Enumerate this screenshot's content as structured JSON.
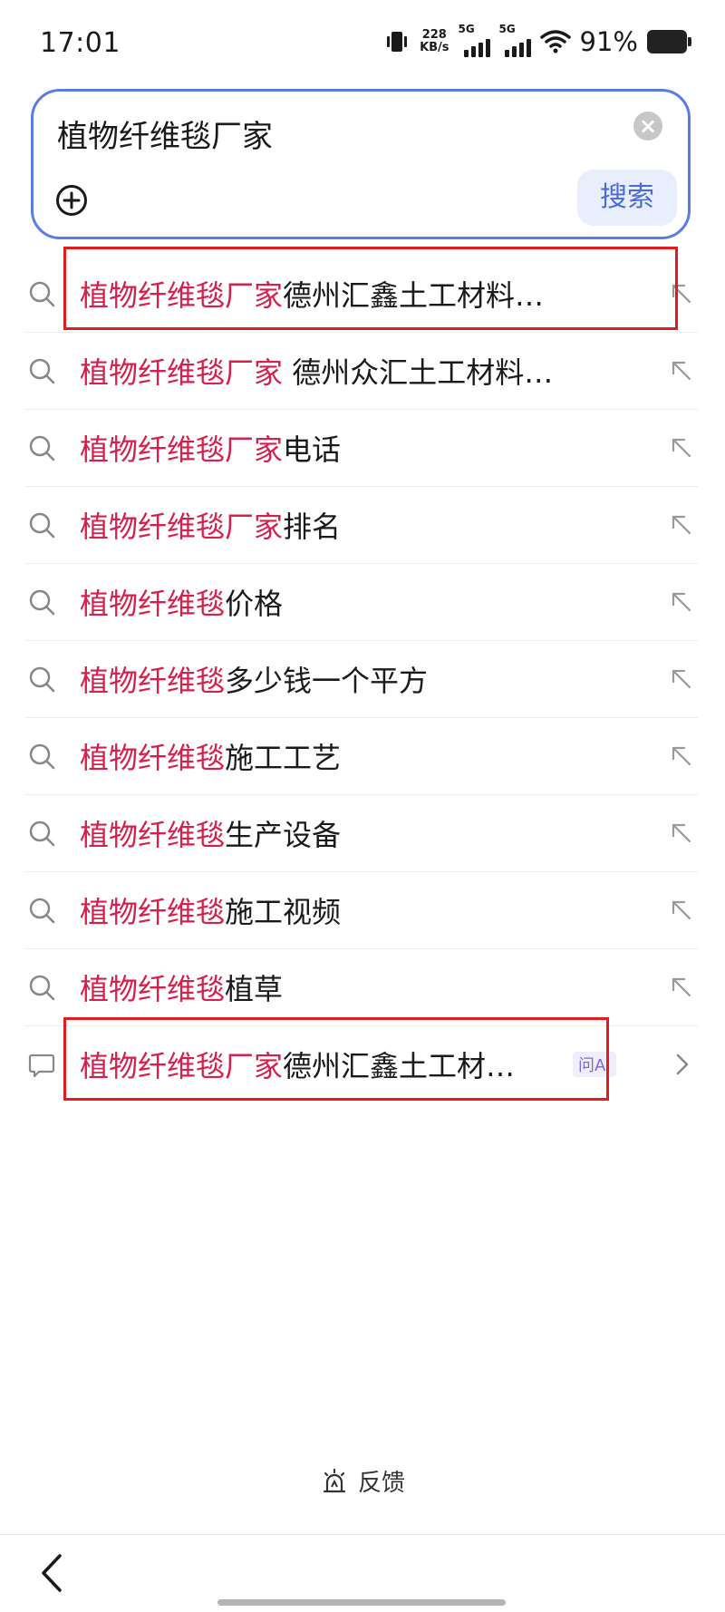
{
  "status_bar": {
    "time": "17:01",
    "net_speed_value": "228",
    "net_speed_unit": "KB/s",
    "sim1_tag": "5G",
    "sim2_tag": "5G",
    "battery_percent": "91%"
  },
  "search": {
    "query": "植物纤维毯厂家",
    "button_label": "搜索",
    "clear_icon": "close-circle-icon",
    "add_icon": "plus-circle-icon"
  },
  "suggestions": [
    {
      "highlight": "植物纤维毯厂家",
      "rest": "德州汇鑫土工材料…",
      "icon": "search-icon",
      "action": "fill-arrow-icon"
    },
    {
      "highlight": "植物纤维毯厂家",
      "rest": " 德州众汇土工材料…",
      "icon": "search-icon",
      "action": "fill-arrow-icon"
    },
    {
      "highlight": "植物纤维毯厂家",
      "rest": "电话",
      "icon": "search-icon",
      "action": "fill-arrow-icon"
    },
    {
      "highlight": "植物纤维毯厂家",
      "rest": "排名",
      "icon": "search-icon",
      "action": "fill-arrow-icon"
    },
    {
      "highlight": "植物纤维毯",
      "rest": "价格",
      "icon": "search-icon",
      "action": "fill-arrow-icon"
    },
    {
      "highlight": "植物纤维毯",
      "rest": "多少钱一个平方",
      "icon": "search-icon",
      "action": "fill-arrow-icon"
    },
    {
      "highlight": "植物纤维毯",
      "rest": "施工工艺",
      "icon": "search-icon",
      "action": "fill-arrow-icon"
    },
    {
      "highlight": "植物纤维毯",
      "rest": "生产设备",
      "icon": "search-icon",
      "action": "fill-arrow-icon"
    },
    {
      "highlight": "植物纤维毯",
      "rest": "施工视频",
      "icon": "search-icon",
      "action": "fill-arrow-icon"
    },
    {
      "highlight": "植物纤维毯",
      "rest": "植草",
      "icon": "search-icon",
      "action": "fill-arrow-icon"
    },
    {
      "highlight": "植物纤维毯厂家",
      "rest": "德州汇鑫土工材…",
      "icon": "chat-bubble-icon",
      "action": "chevron-right-icon",
      "badge": "问AI"
    }
  ],
  "feedback": {
    "label": "反馈",
    "icon": "alarm-light-icon"
  },
  "nav": {
    "back_icon": "back-chevron-icon"
  },
  "colors": {
    "highlight": "#d61f4a",
    "accent": "#5b7be6",
    "annotation": "#e31b1b"
  }
}
